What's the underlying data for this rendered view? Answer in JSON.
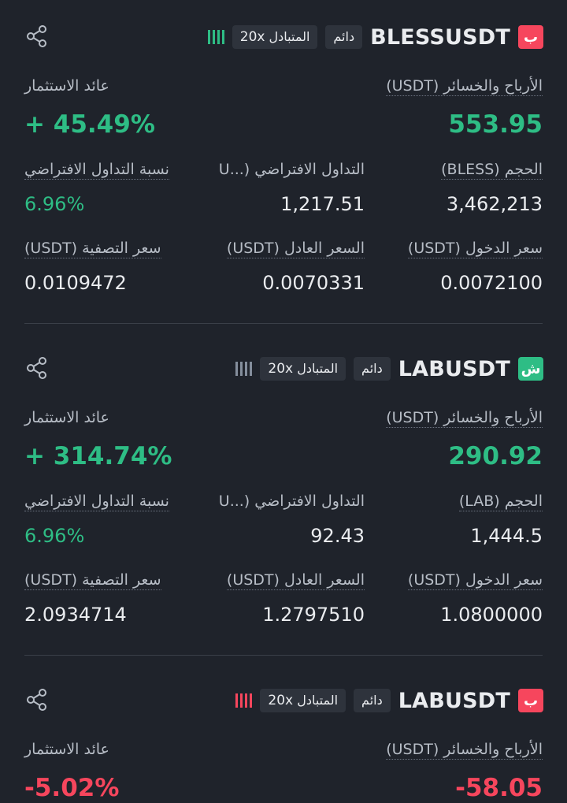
{
  "positions": [
    {
      "side_label": "ب",
      "side_color": "#f6465d",
      "symbol": "BLESSUSDT",
      "type_tag": "دائم",
      "margin_tag": "المتبادل",
      "leverage": "20x",
      "risk_color": "#2ebd85",
      "pnl_label": "الأرباح والخسائر (USDT)",
      "pnl_value": "553.95",
      "roi_label": "عائد الاستثمار",
      "roi_value": "+ 45.49%",
      "pnl_color": "green",
      "size_label": "الحجم (BLESS)",
      "size_value": "3,462,213",
      "margin_label": "التداول الافتراضي (...U",
      "margin_value": "1,217.51",
      "ratio_label": "نسبة التداول الافتراضي",
      "ratio_value": "6.96%",
      "entry_label": "سعر الدخول (USDT)",
      "entry_value": "0.0072100",
      "mark_label": "السعر العادل (USDT)",
      "mark_value": "0.0070331",
      "liq_label": "سعر التصفية (USDT)",
      "liq_value": "0.0109472"
    },
    {
      "side_label": "ش",
      "side_color": "#2ebd85",
      "symbol": "LABUSDT",
      "type_tag": "دائم",
      "margin_tag": "المتبادل",
      "leverage": "20x",
      "risk_color": "#848e9c",
      "pnl_label": "الأرباح والخسائر (USDT)",
      "pnl_value": "290.92",
      "roi_label": "عائد الاستثمار",
      "roi_value": "+ 314.74%",
      "pnl_color": "green",
      "size_label": "الحجم (LAB)",
      "size_value": "1,444.5",
      "margin_label": "التداول الافتراضي (...U",
      "margin_value": "92.43",
      "ratio_label": "نسبة التداول الافتراضي",
      "ratio_value": "6.96%",
      "entry_label": "سعر الدخول (USDT)",
      "entry_value": "1.0800000",
      "mark_label": "السعر العادل (USDT)",
      "mark_value": "1.2797510",
      "liq_label": "سعر التصفية (USDT)",
      "liq_value": "2.0934714"
    },
    {
      "side_label": "ب",
      "side_color": "#f6465d",
      "symbol": "LABUSDT",
      "type_tag": "دائم",
      "margin_tag": "المتبادل",
      "leverage": "20x",
      "risk_color": "#f6465d",
      "pnl_label": "الأرباح والخسائر (USDT)",
      "pnl_value": "-58.05",
      "roi_label": "عائد الاستثمار",
      "roi_value": "-5.02%",
      "pnl_color": "red"
    }
  ]
}
